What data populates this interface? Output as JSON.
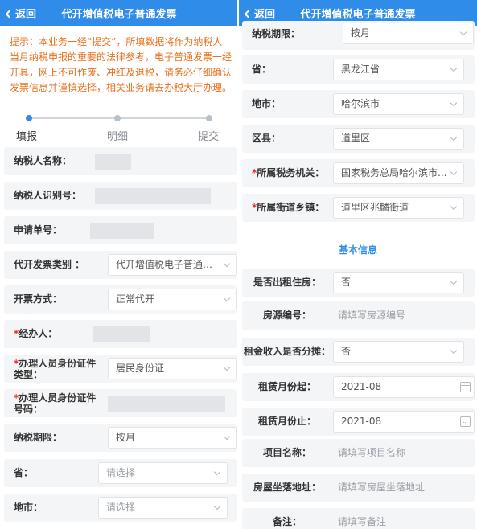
{
  "header": {
    "back_label": "返回",
    "title": "代开增值税电子普通发票"
  },
  "notice": "提示：本业务一经“提交”，所填数据将作为纳税人当月纳税申报的重要的法律参考，电子普通发票一经开具，网上不可作废、冲红及退税，请务必仔细确认发票信息并谨慎选择，相关业务请去办税大厅办理。",
  "steps": [
    "填报",
    "明细",
    "提交"
  ],
  "left": {
    "taxpayer_name": {
      "label": "纳税人名称："
    },
    "taxpayer_id": {
      "label": "纳税人识别号："
    },
    "application_no": {
      "label": "申请单号："
    },
    "invoice_category": {
      "label": "代开发票类别 ：",
      "value": "代开增值税电子普通发..."
    },
    "issue_method": {
      "label": "开票方式：",
      "value": "正常代开"
    },
    "handler": {
      "label": "经办人："
    },
    "id_type": {
      "label1": "办理人员身份证件",
      "label2": "类型：",
      "value": "居民身份证"
    },
    "id_number": {
      "label1": "办理人员身份证件",
      "label2": "号码："
    },
    "tax_period": {
      "label": "纳税期限：",
      "value": "按月"
    },
    "province": {
      "label": "省：",
      "placeholder": "请选择"
    },
    "city": {
      "label": "地市：",
      "placeholder": "请选择"
    }
  },
  "right": {
    "tax_period": {
      "label": "纳税期限：",
      "value": "按月"
    },
    "province": {
      "label": "省：",
      "value": "黑龙江省"
    },
    "city": {
      "label": "地市：",
      "value": "哈尔滨市"
    },
    "district": {
      "label": "区县：",
      "value": "道里区"
    },
    "tax_office": {
      "label": "所属税务机关：",
      "value": "国家税务总局哈尔滨市..."
    },
    "street": {
      "label": "所属街道乡镇：",
      "value": "道里区兆麟街道"
    },
    "section_title": "基本信息",
    "is_rental": {
      "label": "是否出租住房：",
      "value": "否"
    },
    "house_no": {
      "label": "房源编号：",
      "placeholder": "请填写房源编号"
    },
    "rent_split": {
      "label": "租金收入是否分摊：",
      "value": "否"
    },
    "rent_start": {
      "label": "租赁月份起：",
      "value": "2021-08"
    },
    "rent_end": {
      "label": "租赁月份止：",
      "value": "2021-08"
    },
    "project_name": {
      "label": "项目名称：",
      "placeholder": "请填写项目名称"
    },
    "address": {
      "label": "房屋坐落地址：",
      "placeholder": "请填写房屋坐落地址"
    },
    "remark": {
      "label": "备注：",
      "placeholder": "请填写备注"
    }
  },
  "required_mark": "*",
  "colors": {
    "header": "#2f8ce8",
    "notice": "#e8701d",
    "required": "#e0322d",
    "section": "#2f8ce8"
  }
}
